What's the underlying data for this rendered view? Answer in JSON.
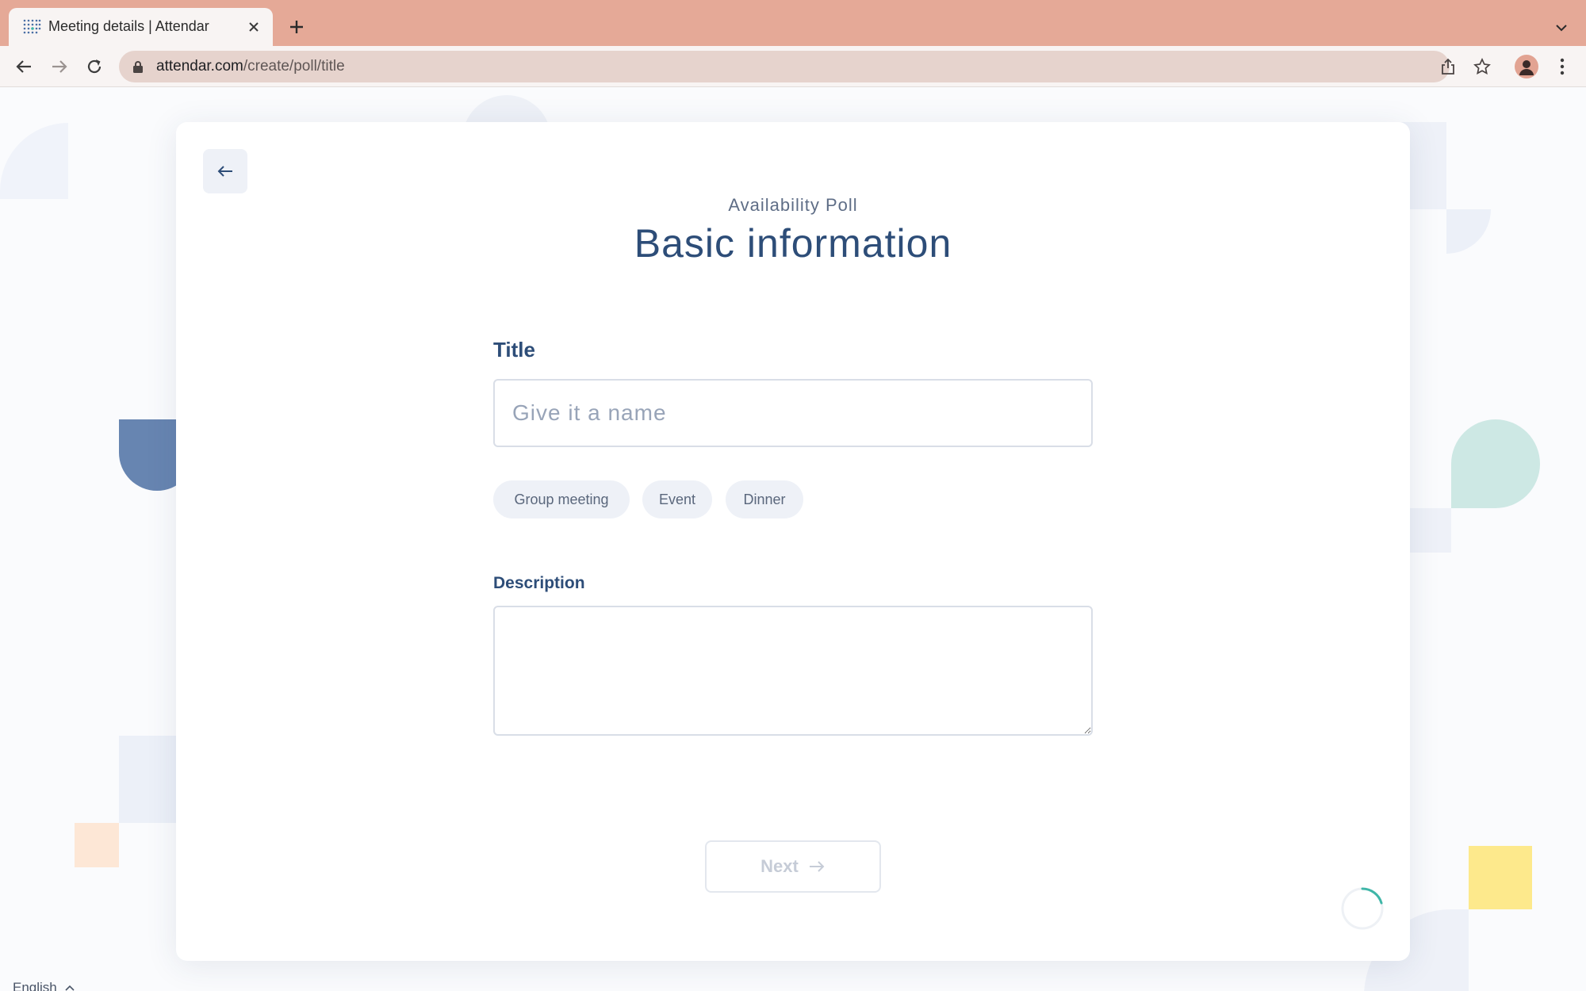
{
  "browser": {
    "tab_title": "Meeting details | Attendar",
    "url_domain": "attendar.com",
    "url_path": "/create/poll/title"
  },
  "icons": {
    "favicon": "attendar-dot-grid-icon",
    "tab_close": "close-icon",
    "new_tab": "plus-icon",
    "tabs_menu": "chevron-down-icon",
    "back": "arrow-left-icon",
    "forward": "arrow-right-icon",
    "reload": "reload-icon",
    "lock": "lock-icon",
    "share": "share-icon",
    "bookmark": "star-icon",
    "profile": "avatar-icon",
    "menu": "kebab-menu-icon",
    "page_back": "arrow-left-icon",
    "next_arrow": "arrow-right-icon",
    "loading": "spinner-icon",
    "language_toggle": "chevron-up-icon"
  },
  "form": {
    "subtitle": "Availability Poll",
    "heading": "Basic information",
    "title_label": "Title",
    "title_placeholder": "Give it a name",
    "title_value": "",
    "suggestions": [
      "Group meeting",
      "Event",
      "Dinner"
    ],
    "description_label": "Description",
    "description_value": "",
    "next_label": "Next"
  },
  "footer": {
    "language": "English"
  },
  "colors": {
    "tabbar": "#e5a997",
    "heading": "#2d4d78",
    "chip_bg": "#eef1f7",
    "disabled_button_text": "#c6ccd7"
  }
}
